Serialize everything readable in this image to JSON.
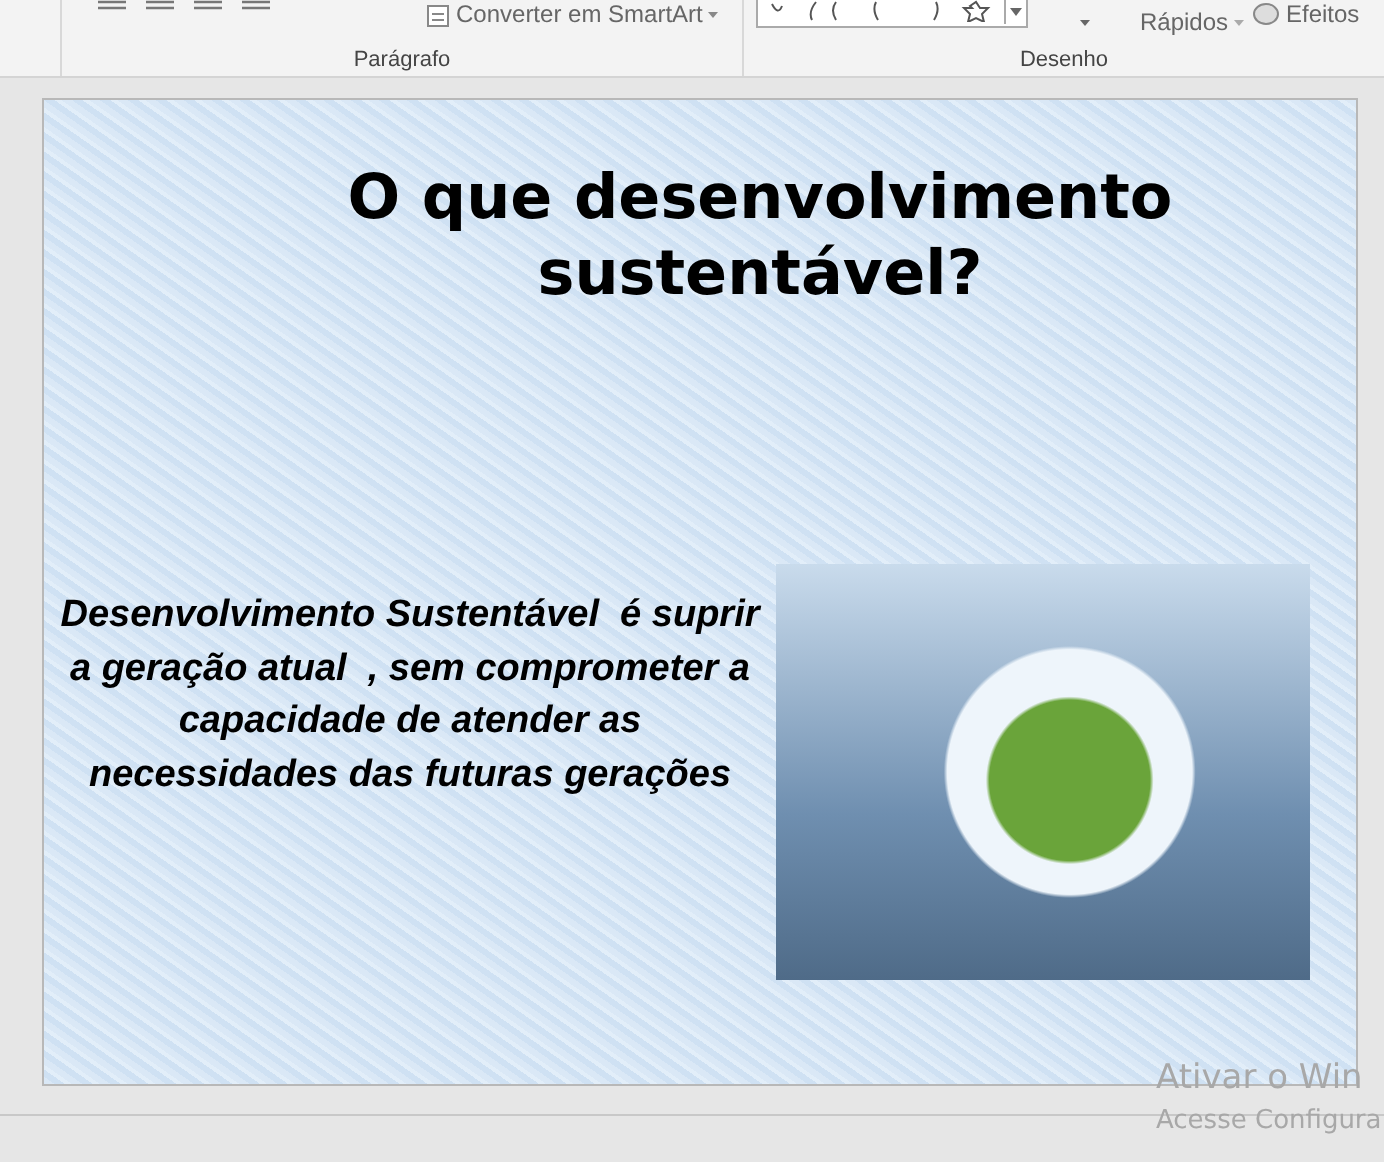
{
  "ribbon": {
    "convert_button": "Converter em SmartArt",
    "quick_styles_button": "Rápidos",
    "effects_button": "Efeitos",
    "groups": [
      "Parágrafo",
      "Desenho"
    ]
  },
  "slide": {
    "title": "O que desenvolvimento sustentável?",
    "body": "Desenvolvimento Sustentável  é suprir a geração atual  , sem comprometer a capacidade de atender as necessidades das futuras gerações"
  },
  "activation_notice": [
    "Ativar o Win",
    "Acesse Configura"
  ]
}
